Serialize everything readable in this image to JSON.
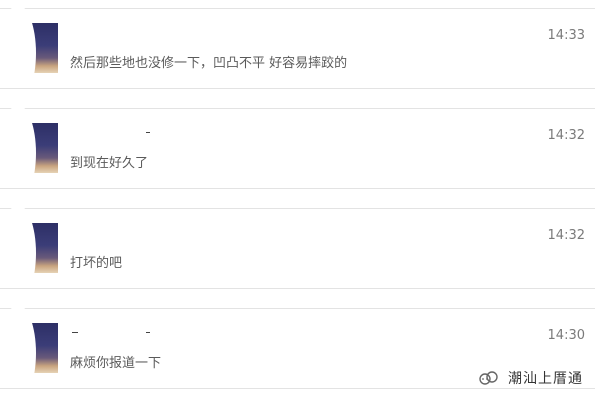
{
  "conversations": [
    {
      "time": "14:33",
      "message": "然后那些地也没修一下，凹凸不平 好容易摔跤的"
    },
    {
      "time": "14:32",
      "message": "到现在好久了"
    },
    {
      "time": "14:32",
      "message": "打坏的吧"
    },
    {
      "time": "14:30",
      "message": "麻烦你报道一下"
    }
  ],
  "watermark": {
    "text": "潮汕上厝通",
    "icon": "wechat-official-account-icon"
  },
  "colors": {
    "divider": "#e3e3e3",
    "text": "#5a5a5a",
    "time": "#7a7a7a"
  }
}
